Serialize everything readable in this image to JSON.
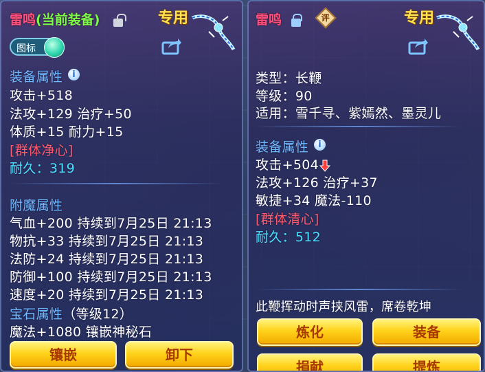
{
  "left_panel": {
    "item_name": "雷鸣",
    "equipped_label": "(当前装备)",
    "exclusive_label": "专用",
    "toggle_label": "图标",
    "equip_attr_header": "装备属性",
    "stats": [
      "攻击+518",
      "法攻+129 治疗+50",
      "体质+15 耐力+15"
    ],
    "special_skill": "[群体净心]",
    "durability": "耐久：319",
    "enchant_header": "附魔属性",
    "enchant_lines": [
      "气血+200 持续到7月25日 21:13",
      "物抗+33 持续到7月25日 21:13",
      "法防+24 持续到7月25日 21:13",
      "防御+100 持续到7月25日 21:13",
      "速度+20 持续到7月25日 21:13"
    ],
    "gem_header": "宝石属性",
    "gem_level": "（等级12）",
    "gem_line": "魔法+1080 镶嵌神秘石",
    "buttons": {
      "inlay": "镶嵌",
      "unequip": "卸下"
    }
  },
  "right_panel": {
    "item_name": "雷鸣",
    "eval_badge": "评",
    "exclusive_label": "专用",
    "type_line": "类型：长鞭",
    "level_line": "等级：90",
    "fit_line": "适用：雪千寻、紫嫣然、墨灵儿",
    "equip_attr_header": "装备属性",
    "stat_attack": "攻击+504",
    "stats": [
      "法攻+126 治疗+37",
      "敏捷+34 魔法-110"
    ],
    "special_skill": "[群体清心]",
    "durability": "耐久：512",
    "description": "此鞭挥动时声挟风雷，席卷乾坤",
    "buttons": {
      "refine": "炼化",
      "equip": "装备",
      "donate": "捐献",
      "extract": "提炼"
    }
  },
  "colors": {
    "name": "#ff4f7a",
    "equipped": "#7cfa4a",
    "exclusive": "#ffe14d",
    "header": "#6fb8ff",
    "skill": "#ff5a6e",
    "durability": "#4be0ff",
    "button": "#ffd21a"
  },
  "icons": {
    "lock_open": "unlock-icon",
    "lock_closed": "lock-icon",
    "weapon": "whip-weapon-icon",
    "share": "share-icon",
    "info": "info-icon",
    "stat_down": "arrow-down-icon"
  }
}
